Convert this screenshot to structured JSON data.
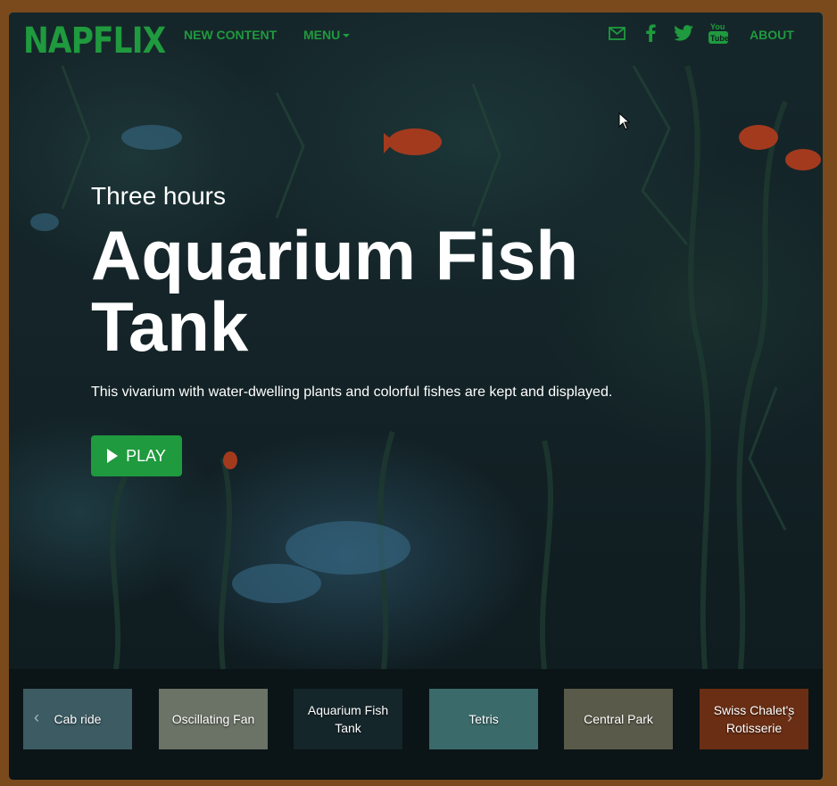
{
  "brand": {
    "logo": "NAPFLIX",
    "accent": "#1f9a3e"
  },
  "nav": {
    "new_content": "NEW CONTENT",
    "menu": "MENU",
    "about": "ABOUT",
    "icons": [
      "mail-icon",
      "facebook-icon",
      "twitter-icon",
      "youtube-icon"
    ]
  },
  "hero": {
    "subtitle": "Three hours",
    "title": "Aquarium Fish Tank",
    "description": "This vivarium with water-dwelling plants and colorful fishes are kept and displayed.",
    "play_label": "PLAY"
  },
  "carousel": {
    "items": [
      {
        "label": "Cab ride",
        "bg": "#3c5b63"
      },
      {
        "label": "Oscillating Fan",
        "bg": "#6b7266"
      },
      {
        "label": "Aquarium Fish Tank",
        "bg": "#15262b"
      },
      {
        "label": "Tetris",
        "bg": "#3a6a6a"
      },
      {
        "label": "Central Park",
        "bg": "#5a5a4a"
      },
      {
        "label": "Swiss Chalet's Rotisserie",
        "bg": "#6a2e14"
      }
    ],
    "prev_icon": "chevron-left-icon",
    "next_icon": "chevron-right-icon"
  }
}
